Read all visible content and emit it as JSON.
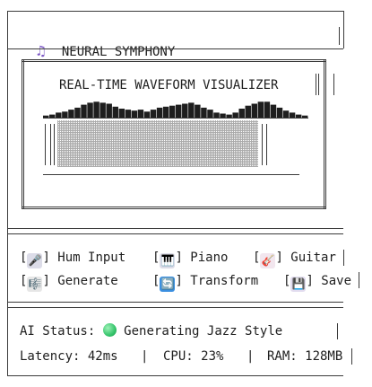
{
  "app": {
    "title_icon": "music-note-icon",
    "title": "NEURAL SYMPHONY"
  },
  "visualizer": {
    "title": "REAL-TIME WAVEFORM VISUALIZER",
    "levels": [
      0.15,
      0.2,
      0.3,
      0.35,
      0.45,
      0.55,
      0.7,
      0.8,
      0.85,
      0.8,
      0.75,
      0.6,
      0.5,
      0.45,
      0.4,
      0.45,
      0.35,
      0.45,
      0.55,
      0.6,
      0.65,
      0.7,
      0.75,
      0.8,
      0.7,
      0.55,
      0.45,
      0.3,
      0.25,
      0.2,
      0.3,
      0.5,
      0.65,
      0.75,
      0.85,
      0.85,
      0.7,
      0.55,
      0.4,
      0.3,
      0.2,
      0.15
    ]
  },
  "actions": {
    "row1": [
      {
        "icon": "microphone-icon",
        "label": "Hum Input"
      },
      {
        "icon": "piano-icon",
        "label": "Piano"
      },
      {
        "icon": "guitar-icon",
        "label": "Guitar"
      }
    ],
    "row2": [
      {
        "icon": "sheet-music-icon",
        "label": "Generate"
      },
      {
        "icon": "cycle-arrows-icon",
        "label": "Transform"
      },
      {
        "icon": "floppy-disk-icon",
        "label": "Save"
      }
    ]
  },
  "status": {
    "label": "AI Status:",
    "indicator_color": "#35c46b",
    "value": "Generating Jazz Style",
    "latency": "Latency: 42ms",
    "cpu": "CPU: 23%",
    "ram": "RAM: 128MB"
  },
  "colors": {
    "text": "#1e1e1e",
    "icon_bg": "#e6e6f0"
  }
}
